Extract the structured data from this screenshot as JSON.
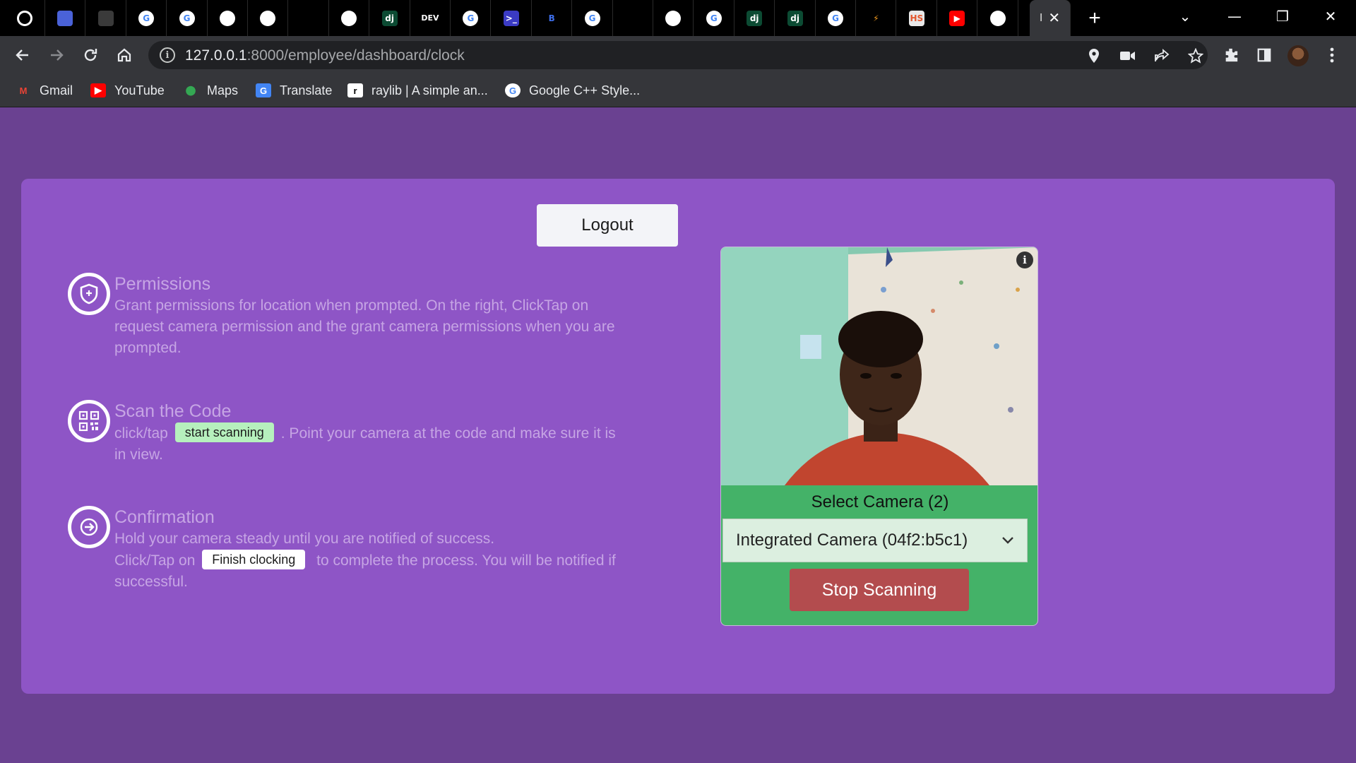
{
  "browser": {
    "tabs": [
      {
        "icon": "github-icon",
        "glyph": "",
        "bg": "#000000",
        "fg": "#ffffff"
      },
      {
        "icon": "chart-site-icon",
        "glyph": "",
        "bg": "#4a62d8",
        "fg": "#ffffff"
      },
      {
        "icon": "dark-logo-icon",
        "glyph": "",
        "bg": "#3a3a3a",
        "fg": "#999999"
      },
      {
        "icon": "google-icon",
        "glyph": "G",
        "bg": "#ffffff",
        "fg": "#4285f4"
      },
      {
        "icon": "google-icon",
        "glyph": "G",
        "bg": "#ffffff",
        "fg": "#4285f4"
      },
      {
        "icon": "feather-icon",
        "glyph": "",
        "bg": "#ffffff",
        "fg": "#000000"
      },
      {
        "icon": "feather-icon",
        "glyph": "",
        "bg": "#ffffff",
        "fg": "#000000"
      },
      {
        "icon": "terminal-icon",
        "glyph": "",
        "bg": "#000000",
        "fg": "#2a6a8a"
      },
      {
        "icon": "play-circle-icon",
        "glyph": "",
        "bg": "#ffffff",
        "fg": "#2aa845"
      },
      {
        "icon": "django-icon",
        "glyph": "dj",
        "bg": "#0c4b33",
        "fg": "#ffffff"
      },
      {
        "icon": "dev-icon",
        "glyph": "DEV",
        "bg": "#000000",
        "fg": "#ffffff"
      },
      {
        "icon": "google-icon",
        "glyph": "G",
        "bg": "#ffffff",
        "fg": "#4285f4"
      },
      {
        "icon": "powershell-icon",
        "glyph": ">_",
        "bg": "#3b3bc4",
        "fg": "#ffffff"
      },
      {
        "icon": "bootstrap-icon",
        "glyph": "B",
        "bg": "#000000",
        "fg": "#3d6eea"
      },
      {
        "icon": "google-icon",
        "glyph": "G",
        "bg": "#ffffff",
        "fg": "#4285f4"
      },
      {
        "icon": "stackoverflow-icon",
        "glyph": "",
        "bg": "#000000",
        "fg": "#f48024"
      },
      {
        "icon": "globe-icon",
        "glyph": "",
        "bg": "#ffffff",
        "fg": "#000000"
      },
      {
        "icon": "google-icon",
        "glyph": "G",
        "bg": "#ffffff",
        "fg": "#4285f4"
      },
      {
        "icon": "django-icon",
        "glyph": "dj",
        "bg": "#0c4b33",
        "fg": "#ffffff"
      },
      {
        "icon": "django-icon",
        "glyph": "dj",
        "bg": "#0c4b33",
        "fg": "#ffffff"
      },
      {
        "icon": "google-icon",
        "glyph": "G",
        "bg": "#ffffff",
        "fg": "#4285f4"
      },
      {
        "icon": "lightning-icon",
        "glyph": "⚡",
        "bg": "#000000",
        "fg": "#f39a1e"
      },
      {
        "icon": "hs-icon",
        "glyph": "HS",
        "bg": "#e8e8e8",
        "fg": "#e4572e"
      },
      {
        "icon": "youtube-icon",
        "glyph": "▶",
        "bg": "#ff0000",
        "fg": "#ffffff"
      },
      {
        "icon": "chrome-icon",
        "glyph": "",
        "bg": "#ffffff",
        "fg": "#000000"
      }
    ],
    "active_tab": {
      "title": "I",
      "close": "✕"
    },
    "new_tab": "+",
    "window_controls": {
      "dropdown": "⌄",
      "minimize": "—",
      "restore": "❐",
      "close": "✕"
    },
    "url_host": "127.0.0.1",
    "url_rest": ":8000/employee/dashboard/clock",
    "bookmarks": [
      {
        "label": "Gmail",
        "icon": "gmail-icon",
        "glyph": "M",
        "fg": "#ea4335",
        "bg": "transparent"
      },
      {
        "label": "YouTube",
        "icon": "youtube-icon",
        "glyph": "▶",
        "fg": "#ffffff",
        "bg": "#ff0000"
      },
      {
        "label": "Maps",
        "icon": "maps-pin-icon",
        "glyph": "⬤",
        "fg": "#34a853",
        "bg": "transparent"
      },
      {
        "label": "Translate",
        "icon": "translate-icon",
        "glyph": "G",
        "fg": "#ffffff",
        "bg": "#4285f4"
      },
      {
        "label": "raylib | A simple an...",
        "icon": "raylib-icon",
        "glyph": "r",
        "fg": "#000000",
        "bg": "#ffffff"
      },
      {
        "label": "Google C++ Style...",
        "icon": "google-icon",
        "glyph": "G",
        "fg": "#4285f4",
        "bg": "#ffffff"
      }
    ]
  },
  "page": {
    "logout_label": "Logout",
    "steps": [
      {
        "icon": "shield-plus-icon",
        "title": "Permissions",
        "text": "Grant permissions for location when prompted. On the right, ClickTap on request camera permission and the grant camera permissions when you are prompted."
      },
      {
        "icon": "qr-code-icon",
        "title": "Scan the Code",
        "text_before": "click/tap",
        "chip": "start scanning",
        "text_after": ". Point your camera at the code and make sure it is in view."
      },
      {
        "icon": "arrow-right-circle-icon",
        "title": "Confirmation",
        "text_line1": "Hold your camera steady until you are notified of success.",
        "text_before": "Click/Tap on",
        "chip": "Finish clocking",
        "text_after": "to complete the process. You will be notified if successful."
      }
    ],
    "scanner": {
      "select_label": "Select Camera (2)",
      "selected_camera": "Integrated Camera (04f2:b5c1)",
      "stop_label": "Stop Scanning",
      "info_glyph": "i"
    }
  },
  "colors": {
    "page_bg": "#6a4191",
    "card_bg": "#8e55c6",
    "muted_text": "#c6a5e4",
    "scanner_bg": "#44b268",
    "stop_button": "#b34c4e"
  }
}
